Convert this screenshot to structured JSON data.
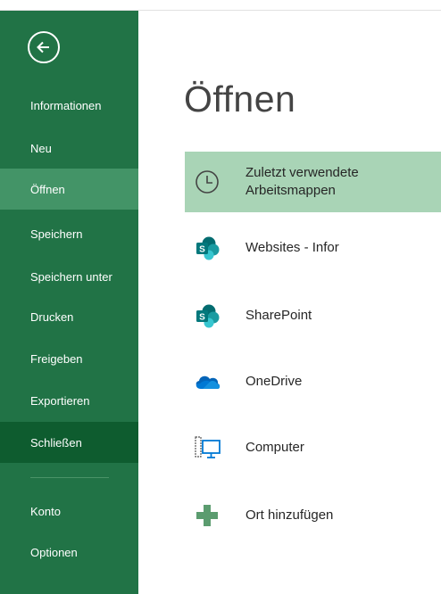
{
  "sidebar": {
    "items": [
      {
        "label": "Informationen"
      },
      {
        "label": "Neu"
      },
      {
        "label": "Öffnen"
      },
      {
        "label": "Speichern"
      },
      {
        "label": "Speichern unter"
      },
      {
        "label": "Drucken"
      },
      {
        "label": "Freigeben"
      },
      {
        "label": "Exportieren"
      },
      {
        "label": "Schließen"
      },
      {
        "label": "Konto"
      },
      {
        "label": "Optionen"
      }
    ],
    "colors": {
      "background": "#217346",
      "selected": "#439467",
      "dark": "#0e5c2f"
    }
  },
  "main": {
    "title": "Öffnen",
    "locations": [
      {
        "label_line1": "Zuletzt verwendete",
        "label_line2": "Arbeitsmappen",
        "icon": "clock-icon",
        "selected": true
      },
      {
        "label": "Websites - Infor",
        "icon": "sharepoint-icon"
      },
      {
        "label": "SharePoint",
        "icon": "sharepoint-icon"
      },
      {
        "label": "OneDrive",
        "icon": "onedrive-cloud-icon"
      },
      {
        "label": "Computer",
        "icon": "computer-icon"
      },
      {
        "label": "Ort hinzufügen",
        "icon": "plus-icon"
      }
    ]
  }
}
